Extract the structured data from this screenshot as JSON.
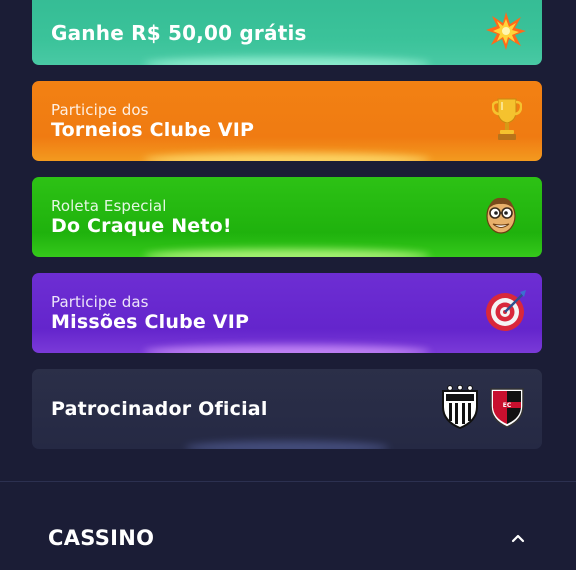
{
  "promos": [
    {
      "main": "Ganhe R$ 50,00 grátis",
      "icon": "explosion-icon"
    },
    {
      "sub": "Participe dos",
      "main": "Torneios Clube VIP",
      "icon": "trophy-icon"
    },
    {
      "sub": "Roleta Especial",
      "main": "Do Craque Neto!",
      "icon": "face-with-glasses-icon"
    },
    {
      "sub": "Participe das",
      "main": "Missões Clube VIP",
      "icon": "dartboard-icon"
    },
    {
      "main": "Patrocinador Oficial",
      "icons": [
        "santos-crest-icon",
        "vitoria-crest-icon"
      ]
    }
  ],
  "section": {
    "title": "CASSINO",
    "icon": "chevron-up-icon",
    "expanded": true
  },
  "colors": {
    "background": "#1b1d36",
    "promo_green_teal": "#3bc39a",
    "promo_orange": "#f07b12",
    "promo_green": "#1fb20d",
    "promo_purple": "#6425cc",
    "promo_dark": "#272b46"
  }
}
